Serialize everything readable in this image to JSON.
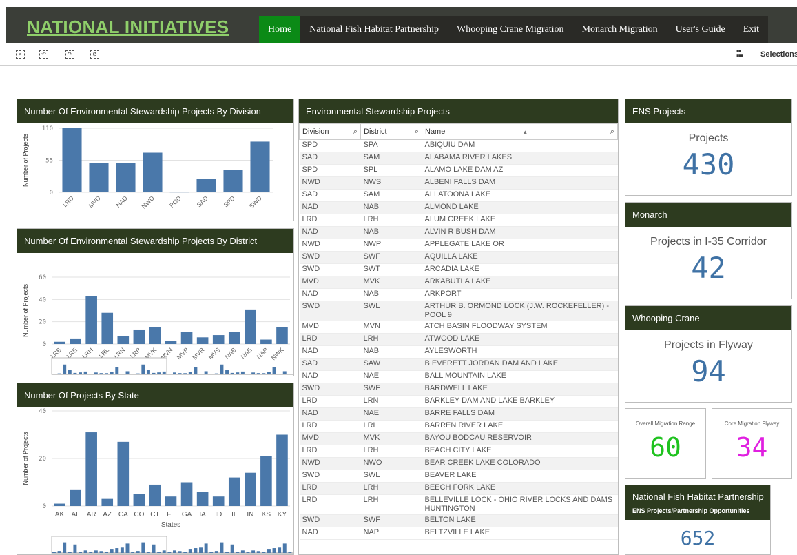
{
  "header": {
    "brand": "NATIONAL INITIATIVES",
    "nav": [
      "Home",
      "National Fish Habitat Partnership",
      "Whooping Crane Migration",
      "Monarch Migration",
      "User's Guide",
      "Exit"
    ],
    "active_nav": "Home",
    "selections_label": "Selections",
    "toolbar_icons": [
      "smart-search-icon",
      "step-back-icon",
      "step-forward-icon",
      "clear-selections-icon"
    ]
  },
  "colors": {
    "header_bg": "#3b3e38",
    "brand": "#8fcf6a",
    "active_nav": "#0b8a16",
    "panel_head": "#2d3b1f",
    "bar": "#4a78aa",
    "kpi_blue": "#3f72a5",
    "kpi_green": "#1fc21f",
    "kpi_magenta": "#e020e0"
  },
  "charts": {
    "division": {
      "title": "Number Of Environmental Stewardship Projects By Division",
      "chart_data": {
        "type": "bar",
        "ylabel": "Number of Projects",
        "ylim": [
          0,
          110
        ],
        "yticks": [
          0,
          55,
          110
        ],
        "categories": [
          "LRD",
          "MVD",
          "NAD",
          "NWD",
          "POD",
          "SAD",
          "SPD",
          "SWD"
        ],
        "values": [
          110,
          50,
          50,
          68,
          1,
          23,
          38,
          87
        ]
      }
    },
    "district": {
      "title": "Number Of Environmental Stewardship Projects By District",
      "chart_data": {
        "type": "bar",
        "ylabel": "Number of Projects",
        "ylim": [
          0,
          60
        ],
        "yticks": [
          0,
          20,
          40,
          60
        ],
        "categories": [
          "LRB",
          "LRE",
          "LRH",
          "LRL",
          "LRN",
          "LRP",
          "MVK",
          "MVN",
          "MVP",
          "MVR",
          "MVS",
          "NAB",
          "NAE",
          "NAP",
          "NWK"
        ],
        "values": [
          2,
          5,
          43,
          28,
          7,
          13,
          15,
          3,
          11,
          6,
          8,
          11,
          31,
          4,
          15
        ]
      }
    },
    "state": {
      "title": "Number Of Projects By State",
      "chart_data": {
        "type": "bar",
        "ylabel": "Number of Projects",
        "xlabel": "States",
        "ylim": [
          0,
          40
        ],
        "yticks": [
          0,
          20,
          40
        ],
        "categories": [
          "AK",
          "AL",
          "AR",
          "AZ",
          "CA",
          "CO",
          "CT",
          "FL",
          "GA",
          "IA",
          "ID",
          "IL",
          "IN",
          "KS",
          "KY"
        ],
        "values": [
          1,
          7,
          31,
          3,
          27,
          5,
          9,
          4,
          10,
          6,
          4,
          12,
          14,
          21,
          30
        ]
      }
    }
  },
  "table": {
    "title": "Environmental Stewardship Projects",
    "columns": [
      "Division",
      "District",
      "Name"
    ],
    "rows": [
      [
        "SPD",
        "SPA",
        "ABIQUIU DAM"
      ],
      [
        "SAD",
        "SAM",
        "ALABAMA RIVER LAKES"
      ],
      [
        "SPD",
        "SPL",
        "ALAMO LAKE DAM AZ"
      ],
      [
        "NWD",
        "NWS",
        "ALBENI FALLS DAM"
      ],
      [
        "SAD",
        "SAM",
        "ALLATOONA LAKE"
      ],
      [
        "NAD",
        "NAB",
        "ALMOND LAKE"
      ],
      [
        "LRD",
        "LRH",
        "ALUM CREEK LAKE"
      ],
      [
        "NAD",
        "NAB",
        "ALVIN R BUSH DAM"
      ],
      [
        "NWD",
        "NWP",
        "APPLEGATE LAKE OR"
      ],
      [
        "SWD",
        "SWF",
        "AQUILLA LAKE"
      ],
      [
        "SWD",
        "SWT",
        "ARCADIA LAKE"
      ],
      [
        "MVD",
        "MVK",
        "ARKABUTLA LAKE"
      ],
      [
        "NAD",
        "NAB",
        "ARKPORT"
      ],
      [
        "SWD",
        "SWL",
        "ARTHUR B. ORMOND LOCK (J.W. ROCKEFELLER) - POOL 9"
      ],
      [
        "MVD",
        "MVN",
        "ATCH BASIN FLOODWAY SYSTEM"
      ],
      [
        "LRD",
        "LRH",
        "ATWOOD LAKE"
      ],
      [
        "NAD",
        "NAB",
        "AYLESWORTH"
      ],
      [
        "SAD",
        "SAW",
        "B EVERETT JORDAN DAM AND LAKE"
      ],
      [
        "NAD",
        "NAE",
        "BALL MOUNTAIN LAKE"
      ],
      [
        "SWD",
        "SWF",
        "BARDWELL LAKE"
      ],
      [
        "LRD",
        "LRN",
        "BARKLEY DAM AND LAKE BARKLEY"
      ],
      [
        "NAD",
        "NAE",
        "BARRE FALLS DAM"
      ],
      [
        "LRD",
        "LRL",
        "BARREN RIVER LAKE"
      ],
      [
        "MVD",
        "MVK",
        "BAYOU BODCAU RESERVOIR"
      ],
      [
        "LRD",
        "LRH",
        "BEACH CITY LAKE"
      ],
      [
        "NWD",
        "NWO",
        "BEAR CREEK LAKE COLORADO"
      ],
      [
        "SWD",
        "SWL",
        "BEAVER LAKE"
      ],
      [
        "LRD",
        "LRH",
        "BEECH FORK LAKE"
      ],
      [
        "LRD",
        "LRH",
        "BELLEVILLE LOCK - OHIO RIVER LOCKS AND DAMS HUNTINGTON"
      ],
      [
        "SWD",
        "SWF",
        "BELTON LAKE"
      ],
      [
        "NAD",
        "NAP",
        "BELTZVILLE LAKE"
      ]
    ]
  },
  "kpis": {
    "ens": {
      "header": "ENS Projects",
      "title": "Projects",
      "value": "430"
    },
    "monarch": {
      "header": "Monarch",
      "title": "Projects in I-35 Corridor",
      "value": "42"
    },
    "crane": {
      "header": "Whooping Crane",
      "title": "Projects in Flyway",
      "value": "94"
    },
    "overall": {
      "title": "Overall Migration Range",
      "value": "60"
    },
    "core": {
      "title": "Core Migration Flyway",
      "value": "34"
    },
    "fish": {
      "header": "National Fish Habitat Partnership",
      "subheader": "ENS Projects/Partnership Opportunities",
      "value": "652"
    }
  }
}
